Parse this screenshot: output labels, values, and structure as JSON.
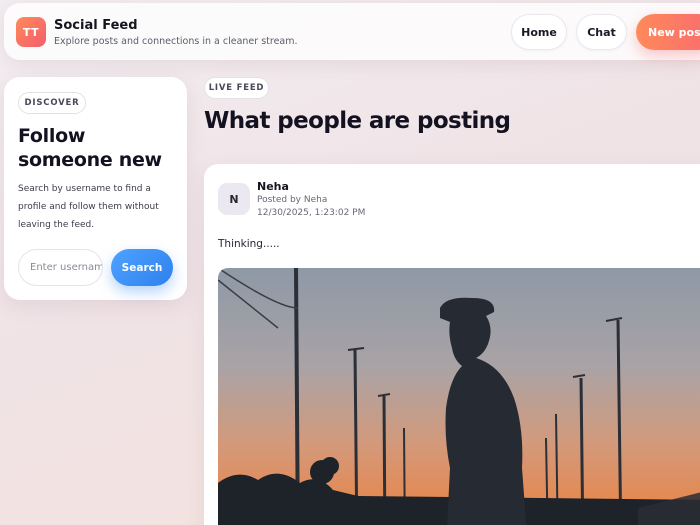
{
  "header": {
    "logo_text": "TT",
    "title": "Social Feed",
    "subtitle": "Explore posts and connections in a cleaner stream.",
    "nav": {
      "home": "Home",
      "chat": "Chat",
      "new_post": "New post"
    }
  },
  "discover": {
    "badge": "DISCOVER",
    "title": "Follow someone new",
    "description": "Search by username to find a profile and follow them without leaving the feed.",
    "search_placeholder": "Enter username",
    "search_button": "Search"
  },
  "feed": {
    "badge": "LIVE FEED",
    "title": "What people are posting"
  },
  "post": {
    "avatar_initial": "N",
    "author": "Neha",
    "posted_by": "Posted by Neha",
    "timestamp": "12/30/2025, 1:23:02 PM",
    "text": "Thinking.....",
    "image_icon": "silhouette-sunset-photo"
  },
  "colors": {
    "accent_orange": "#ff8a5b",
    "accent_blue": "#2f80ed"
  }
}
